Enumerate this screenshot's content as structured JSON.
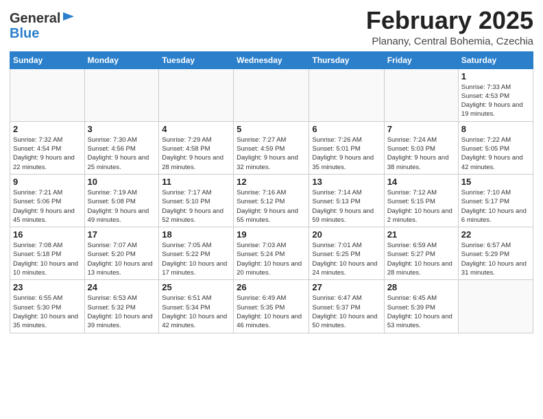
{
  "header": {
    "logo_general": "General",
    "logo_blue": "Blue",
    "month": "February 2025",
    "location": "Planany, Central Bohemia, Czechia"
  },
  "weekdays": [
    "Sunday",
    "Monday",
    "Tuesday",
    "Wednesday",
    "Thursday",
    "Friday",
    "Saturday"
  ],
  "weeks": [
    [
      {
        "day": "",
        "sunrise": "",
        "sunset": "",
        "daylight": ""
      },
      {
        "day": "",
        "sunrise": "",
        "sunset": "",
        "daylight": ""
      },
      {
        "day": "",
        "sunrise": "",
        "sunset": "",
        "daylight": ""
      },
      {
        "day": "",
        "sunrise": "",
        "sunset": "",
        "daylight": ""
      },
      {
        "day": "",
        "sunrise": "",
        "sunset": "",
        "daylight": ""
      },
      {
        "day": "",
        "sunrise": "",
        "sunset": "",
        "daylight": ""
      },
      {
        "day": "1",
        "sunrise": "7:33 AM",
        "sunset": "4:53 PM",
        "daylight": "9 hours and 19 minutes."
      }
    ],
    [
      {
        "day": "2",
        "sunrise": "7:32 AM",
        "sunset": "4:54 PM",
        "daylight": "9 hours and 22 minutes."
      },
      {
        "day": "3",
        "sunrise": "7:30 AM",
        "sunset": "4:56 PM",
        "daylight": "9 hours and 25 minutes."
      },
      {
        "day": "4",
        "sunrise": "7:29 AM",
        "sunset": "4:58 PM",
        "daylight": "9 hours and 28 minutes."
      },
      {
        "day": "5",
        "sunrise": "7:27 AM",
        "sunset": "4:59 PM",
        "daylight": "9 hours and 32 minutes."
      },
      {
        "day": "6",
        "sunrise": "7:26 AM",
        "sunset": "5:01 PM",
        "daylight": "9 hours and 35 minutes."
      },
      {
        "day": "7",
        "sunrise": "7:24 AM",
        "sunset": "5:03 PM",
        "daylight": "9 hours and 38 minutes."
      },
      {
        "day": "8",
        "sunrise": "7:22 AM",
        "sunset": "5:05 PM",
        "daylight": "9 hours and 42 minutes."
      }
    ],
    [
      {
        "day": "9",
        "sunrise": "7:21 AM",
        "sunset": "5:06 PM",
        "daylight": "9 hours and 45 minutes."
      },
      {
        "day": "10",
        "sunrise": "7:19 AM",
        "sunset": "5:08 PM",
        "daylight": "9 hours and 49 minutes."
      },
      {
        "day": "11",
        "sunrise": "7:17 AM",
        "sunset": "5:10 PM",
        "daylight": "9 hours and 52 minutes."
      },
      {
        "day": "12",
        "sunrise": "7:16 AM",
        "sunset": "5:12 PM",
        "daylight": "9 hours and 55 minutes."
      },
      {
        "day": "13",
        "sunrise": "7:14 AM",
        "sunset": "5:13 PM",
        "daylight": "9 hours and 59 minutes."
      },
      {
        "day": "14",
        "sunrise": "7:12 AM",
        "sunset": "5:15 PM",
        "daylight": "10 hours and 2 minutes."
      },
      {
        "day": "15",
        "sunrise": "7:10 AM",
        "sunset": "5:17 PM",
        "daylight": "10 hours and 6 minutes."
      }
    ],
    [
      {
        "day": "16",
        "sunrise": "7:08 AM",
        "sunset": "5:18 PM",
        "daylight": "10 hours and 10 minutes."
      },
      {
        "day": "17",
        "sunrise": "7:07 AM",
        "sunset": "5:20 PM",
        "daylight": "10 hours and 13 minutes."
      },
      {
        "day": "18",
        "sunrise": "7:05 AM",
        "sunset": "5:22 PM",
        "daylight": "10 hours and 17 minutes."
      },
      {
        "day": "19",
        "sunrise": "7:03 AM",
        "sunset": "5:24 PM",
        "daylight": "10 hours and 20 minutes."
      },
      {
        "day": "20",
        "sunrise": "7:01 AM",
        "sunset": "5:25 PM",
        "daylight": "10 hours and 24 minutes."
      },
      {
        "day": "21",
        "sunrise": "6:59 AM",
        "sunset": "5:27 PM",
        "daylight": "10 hours and 28 minutes."
      },
      {
        "day": "22",
        "sunrise": "6:57 AM",
        "sunset": "5:29 PM",
        "daylight": "10 hours and 31 minutes."
      }
    ],
    [
      {
        "day": "23",
        "sunrise": "6:55 AM",
        "sunset": "5:30 PM",
        "daylight": "10 hours and 35 minutes."
      },
      {
        "day": "24",
        "sunrise": "6:53 AM",
        "sunset": "5:32 PM",
        "daylight": "10 hours and 39 minutes."
      },
      {
        "day": "25",
        "sunrise": "6:51 AM",
        "sunset": "5:34 PM",
        "daylight": "10 hours and 42 minutes."
      },
      {
        "day": "26",
        "sunrise": "6:49 AM",
        "sunset": "5:35 PM",
        "daylight": "10 hours and 46 minutes."
      },
      {
        "day": "27",
        "sunrise": "6:47 AM",
        "sunset": "5:37 PM",
        "daylight": "10 hours and 50 minutes."
      },
      {
        "day": "28",
        "sunrise": "6:45 AM",
        "sunset": "5:39 PM",
        "daylight": "10 hours and 53 minutes."
      },
      {
        "day": "",
        "sunrise": "",
        "sunset": "",
        "daylight": ""
      }
    ]
  ]
}
